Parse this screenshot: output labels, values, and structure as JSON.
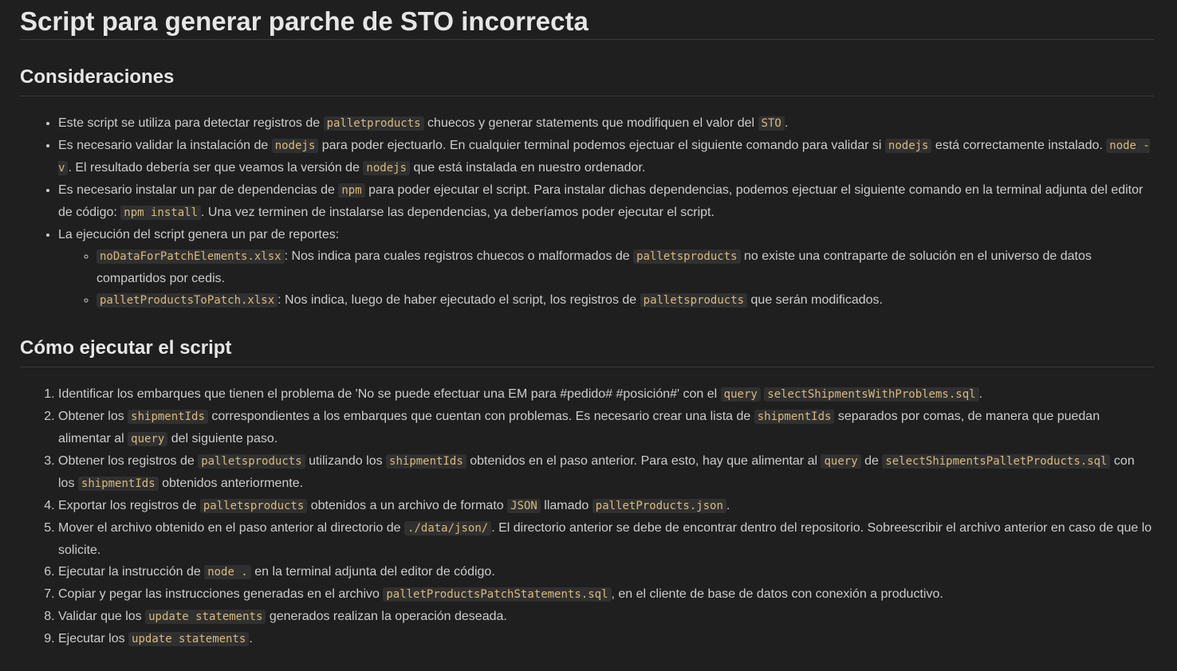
{
  "title": "Script para generar parche de STO incorrecta",
  "sections": {
    "consideraciones": {
      "heading": "Consideraciones",
      "items": [
        {
          "p1": "Este script se utiliza para detectar registros de ",
          "c1": "palletproducts",
          "p2": " chuecos y generar statements que modifiquen el valor del ",
          "c2": "STO",
          "p3": "."
        },
        {
          "p1": "Es necesario validar la instalación de ",
          "c1": "nodejs",
          "p2": " para poder ejectuarlo. En cualquier terminal podemos ejectuar el siguiente comando para validar si ",
          "c2": "nodejs",
          "p3": " está correctamente instalado. ",
          "c3": "node -v",
          "p4": ". El resultado debería ser que veamos la versión de ",
          "c4": "nodejs",
          "p5": " que está instalada en nuestro ordenador."
        },
        {
          "p1": "Es necesario instalar un par de dependencias de ",
          "c1": "npm",
          "p2": " para poder ejecutar el script. Para instalar dichas dependencias, podemos ejectuar el siguiente comando en la terminal adjunta del editor de código: ",
          "c2": "npm install",
          "p3": ". Una vez terminen de instalarse las dependencias, ya deberíamos poder ejecutar el script."
        },
        {
          "p1": "La ejecución del script genera un par de reportes:",
          "sub": [
            {
              "c1": "noDataForPatchElements.xlsx",
              "p1": ": Nos indica para cuales registros chuecos o malformados de ",
              "c2": "palletsproducts",
              "p2": " no existe una contraparte de solución en el universo de datos compartidos por cedis."
            },
            {
              "c1": "palletProductsToPatch.xlsx",
              "p1": ": Nos indica, luego de haber ejecutado el script, los registros de ",
              "c2": "palletsproducts",
              "p2": " que serán modificados."
            }
          ]
        }
      ]
    },
    "ejecutar": {
      "heading": "Cómo ejecutar el script",
      "steps": [
        {
          "p1": "Identificar los embarques que tienen el problema de 'No se puede efectuar una EM para #pedido# #posición#' con el ",
          "c1": "query",
          "p2": " ",
          "c2": "selectShipmentsWithProblems.sql",
          "p3": "."
        },
        {
          "p1": "Obtener los ",
          "c1": "shipmentIds",
          "p2": " correspondientes a los embarques que cuentan con problemas. Es necesario crear una lista de ",
          "c2": "shipmentIds",
          "p3": " separados por comas, de manera que puedan alimentar al ",
          "c3": "query",
          "p4": " del siguiente paso."
        },
        {
          "p1": "Obtener los registros de ",
          "c1": "palletsproducts",
          "p2": " utilizando los ",
          "c2": "shipmentIds",
          "p3": " obtenidos en el paso anterior. Para esto, hay que alimentar al ",
          "c3": "query",
          "p4": " de ",
          "c4": "selectShipmentsPalletProducts.sql",
          "p5": " con los ",
          "c5": "shipmentIds",
          "p6": " obtenidos anteriormente."
        },
        {
          "p1": "Exportar los registros de ",
          "c1": "palletsproducts",
          "p2": " obtenidos a un archivo de formato ",
          "c2": "JSON",
          "p3": " llamado ",
          "c3": "palletProducts.json",
          "p4": "."
        },
        {
          "p1": "Mover el archivo obtenido en el paso anterior al directorio de ",
          "c1": "./data/json/",
          "p2": ". El directorio anterior se debe de encontrar dentro del repositorio. Sobreescribir el archivo anterior en caso de que lo solicite."
        },
        {
          "p1": "Ejecutar la instrucción de ",
          "c1": "node .",
          "p2": " en la terminal adjunta del editor de código."
        },
        {
          "p1": "Copiar y pegar las instrucciones generadas en el archivo ",
          "c1": "palletProductsPatchStatements.sql",
          "p2": ", en el cliente de base de datos con conexión a productivo."
        },
        {
          "p1": "Validar que los ",
          "c1": "update statements",
          "p2": " generados realizan la operación deseada."
        },
        {
          "p1": "Ejecutar los ",
          "c1": "update statements",
          "p2": "."
        }
      ]
    }
  }
}
